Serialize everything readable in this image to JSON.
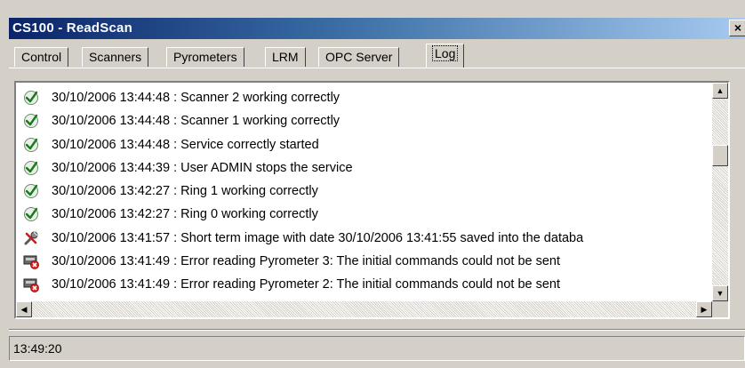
{
  "window": {
    "title": "CS100 - ReadScan",
    "close_label": "×"
  },
  "tabs": [
    {
      "label": "Control",
      "active": false
    },
    {
      "label": "Scanners",
      "active": false
    },
    {
      "label": "Pyrometers",
      "active": false
    },
    {
      "label": "LRM",
      "active": false
    },
    {
      "label": "OPC Server",
      "active": false
    },
    {
      "label": "Log",
      "active": true
    }
  ],
  "log": [
    {
      "icon": "check-icon",
      "text": "30/10/2006 13:44:48 : Scanner 2 working correctly"
    },
    {
      "icon": "check-icon",
      "text": "30/10/2006 13:44:48 : Scanner 1 working correctly"
    },
    {
      "icon": "check-icon",
      "text": "30/10/2006 13:44:48 : Service correctly started"
    },
    {
      "icon": "check-icon",
      "text": "30/10/2006 13:44:39 : User ADMIN stops the service"
    },
    {
      "icon": "check-icon",
      "text": "30/10/2006 13:42:27 : Ring 1 working correctly"
    },
    {
      "icon": "check-icon",
      "text": "30/10/2006 13:42:27 : Ring 0 working correctly"
    },
    {
      "icon": "tools-icon",
      "text": "30/10/2006 13:41:57 : Short term image with date 30/10/2006 13:41:55 saved into the databa"
    },
    {
      "icon": "error-device-icon",
      "text": "30/10/2006 13:41:49 : Error reading Pyrometer 3: The initial commands could not be sent"
    },
    {
      "icon": "error-device-icon",
      "text": "30/10/2006 13:41:49 : Error reading Pyrometer 2: The initial commands could not be sent"
    }
  ],
  "status": {
    "time": "13:49:20"
  },
  "colors": {
    "title_bar_start": "#0a246a",
    "title_bar_end": "#a6caf0",
    "face": "#d4d0c8"
  }
}
